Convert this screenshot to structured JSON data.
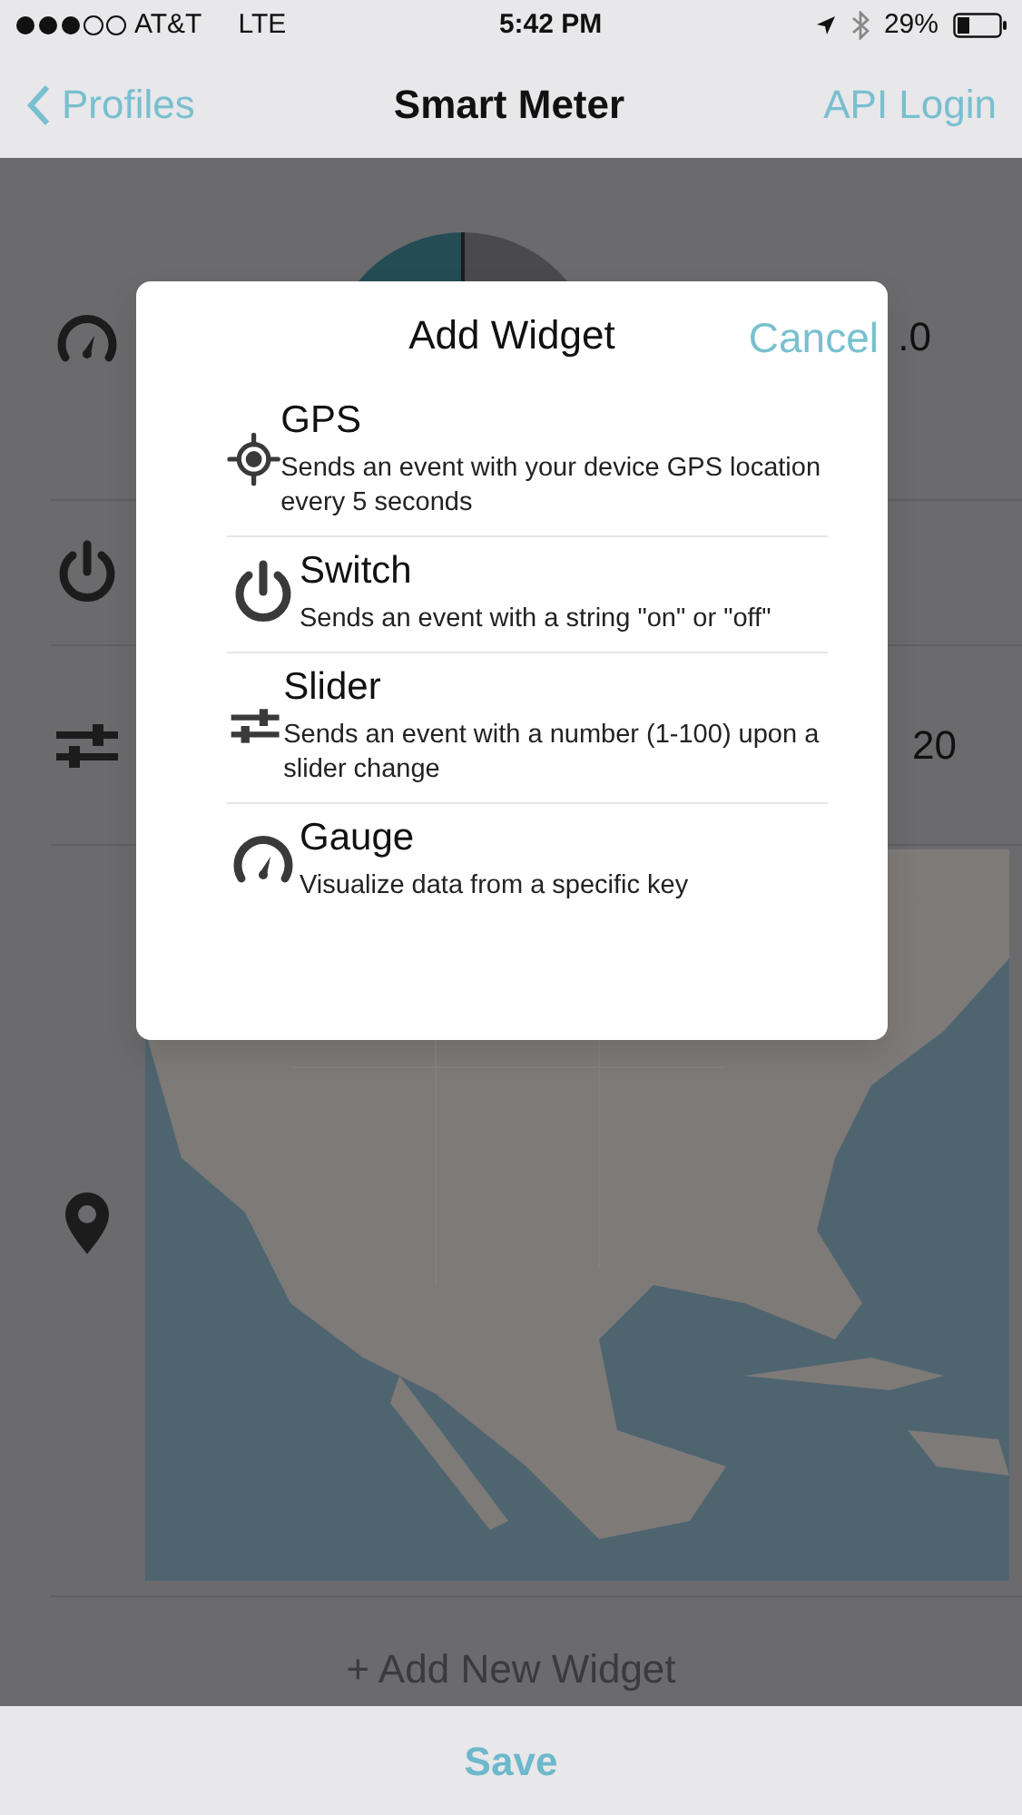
{
  "status_bar": {
    "carrier": "AT&T",
    "network": "LTE",
    "time": "5:42 PM",
    "battery": "29%"
  },
  "nav": {
    "back": "Profiles",
    "title": "Smart Meter",
    "action": "API Login"
  },
  "widgets": [
    {
      "kind": "gauge",
      "value": ".0"
    },
    {
      "kind": "switch"
    },
    {
      "kind": "slider",
      "value": "20"
    },
    {
      "kind": "map"
    }
  ],
  "add_widget": "+ Add New Widget",
  "save": "Save",
  "dialog": {
    "title": "Add Widget",
    "cancel": "Cancel",
    "options": [
      {
        "kind": "gps",
        "title": "GPS",
        "description": "Sends an event with your device GPS location every 5 seconds"
      },
      {
        "kind": "switch",
        "title": "Switch",
        "description": "Sends an event with a string \"on\" or \"off\""
      },
      {
        "kind": "slider",
        "title": "Slider",
        "description": "Sends an event with a number (1-100) upon a slider change"
      },
      {
        "kind": "gauge",
        "title": "Gauge",
        "description": "Visualize data from a specific key"
      }
    ]
  }
}
